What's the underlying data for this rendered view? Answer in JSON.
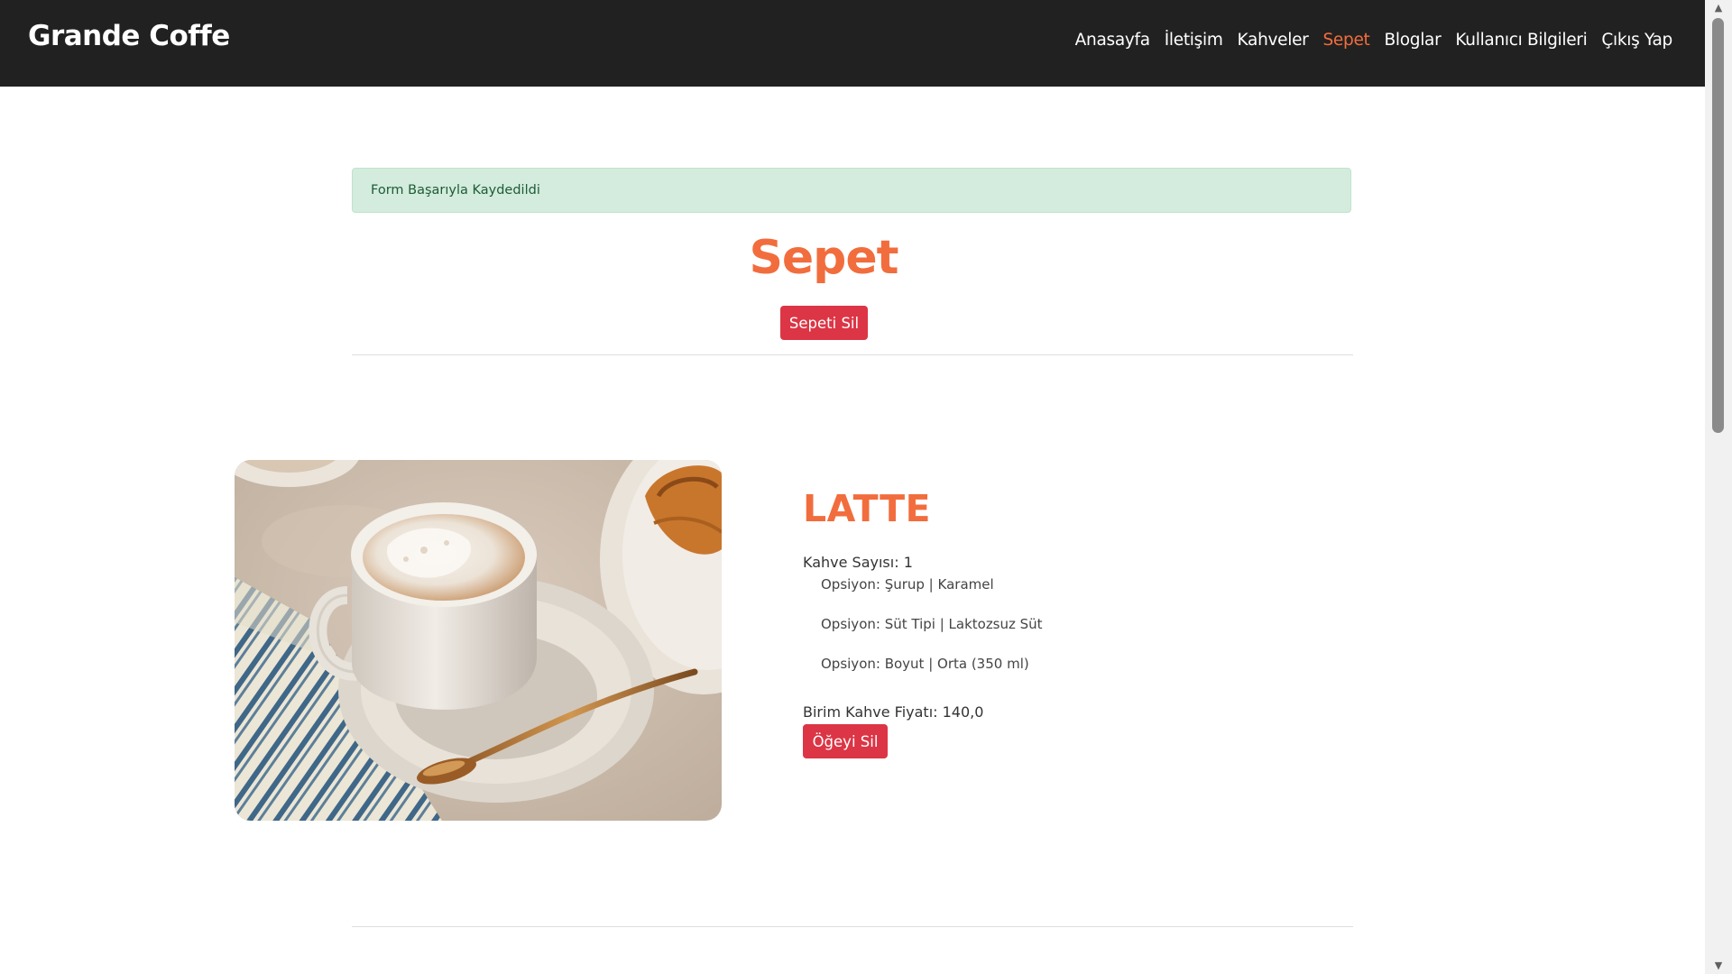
{
  "brand": {
    "name": "Grande Coffe"
  },
  "nav": {
    "items": [
      {
        "label": "Anasayfa",
        "active": false
      },
      {
        "label": "İletişim",
        "active": false
      },
      {
        "label": "Kahveler",
        "active": false
      },
      {
        "label": "Sepet",
        "active": true
      },
      {
        "label": "Bloglar",
        "active": false
      },
      {
        "label": "Kullanıcı Bilgileri",
        "active": false
      },
      {
        "label": "Çıkış Yap",
        "active": false
      }
    ]
  },
  "alert": {
    "message": "Form Başarıyla Kaydedildi"
  },
  "cart": {
    "title": "Sepet",
    "clear_label": "Sepeti Sil",
    "item": {
      "name": "LATTE",
      "quantity_text": "Kahve Sayısı: 1",
      "options": [
        "Opsiyon: Şurup | Karamel",
        "Opsiyon: Süt Tipi | Laktozsuz Süt",
        "Opsiyon: Boyut | Orta (350 ml)"
      ],
      "price_text": "Birim Kahve Fiyatı: 140,0",
      "remove_label": "Öğeyi Sil"
    }
  },
  "colors": {
    "navbar_bg": "#212121",
    "accent": "#f26d3d",
    "danger": "#dc3545",
    "alert_bg": "#d3ecdd",
    "alert_text": "#1e5b37"
  }
}
